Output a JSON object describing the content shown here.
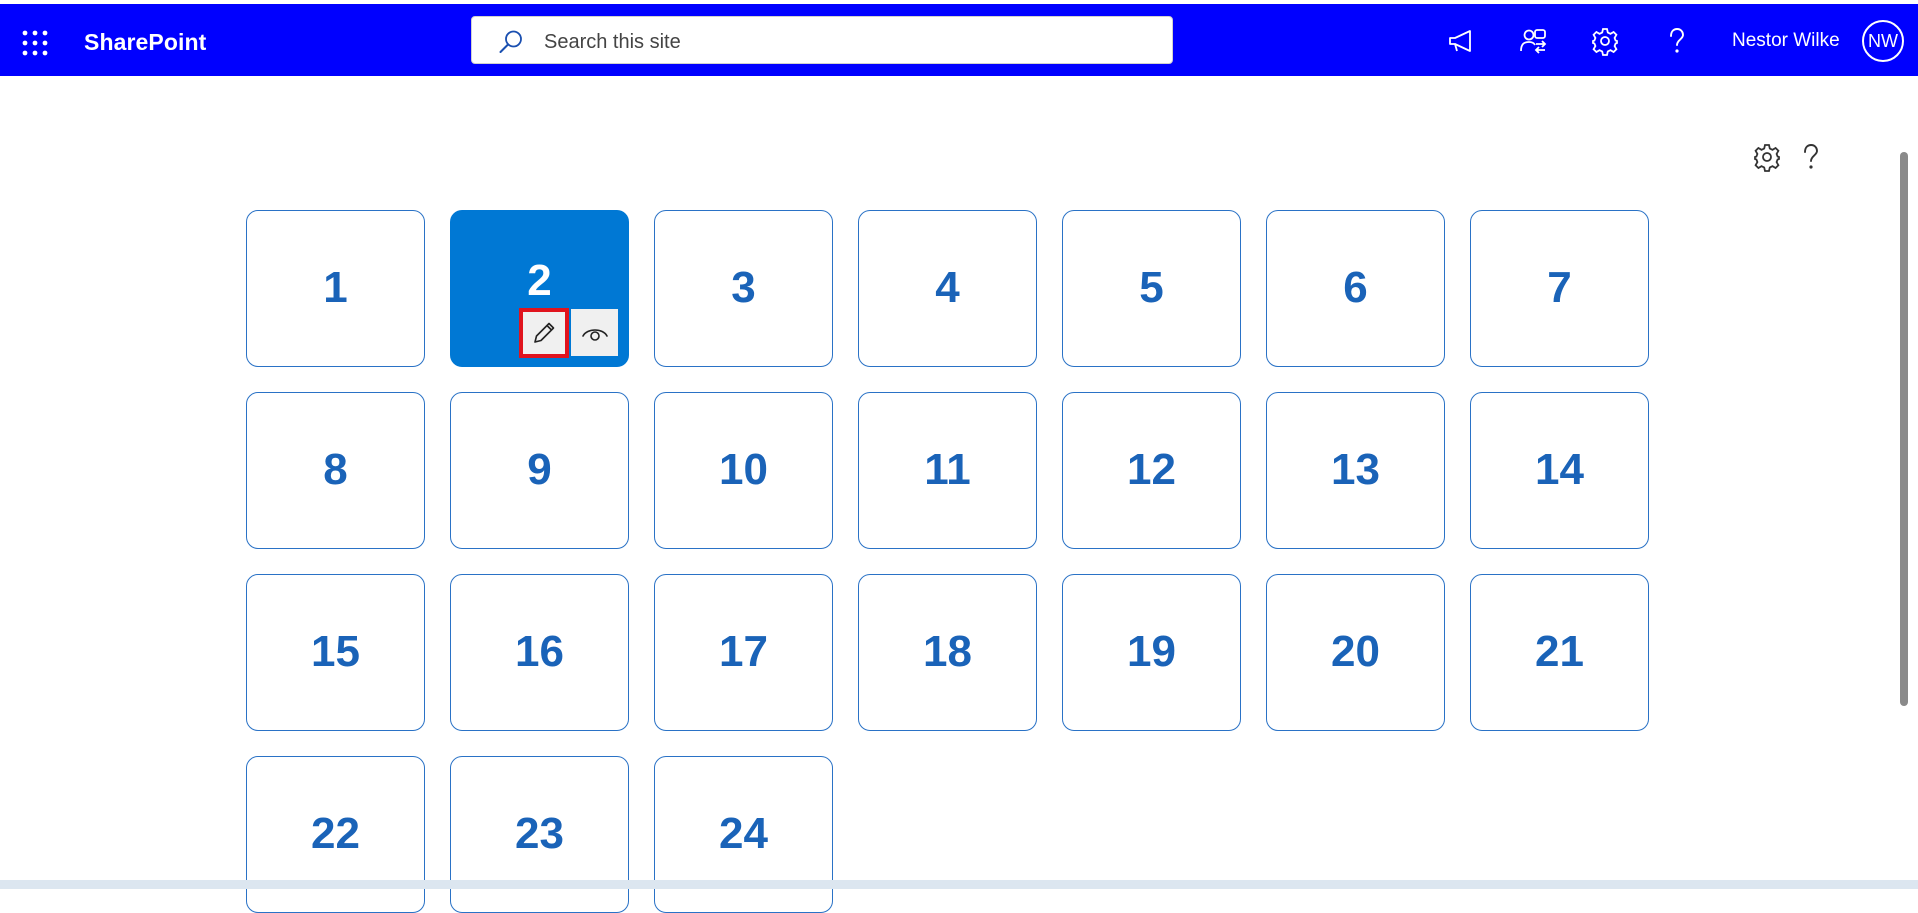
{
  "suite_bar": {
    "brand": "SharePoint",
    "background": "#0000ff",
    "search": {
      "placeholder": "Search this site",
      "value": ""
    },
    "icons": [
      "app-launcher-icon",
      "announcement-icon",
      "people-switch-icon",
      "gear-icon",
      "help-icon"
    ],
    "user": {
      "name": "Nestor Wilke",
      "initials": "NW"
    }
  },
  "page_tools": {
    "icons": [
      "gear-icon",
      "help-icon"
    ]
  },
  "grid": {
    "accent": "#2a72c6",
    "selected_fill": "#0078d4",
    "tiles": [
      "1",
      "2",
      "3",
      "4",
      "5",
      "6",
      "7",
      "8",
      "9",
      "10",
      "11",
      "12",
      "13",
      "14",
      "15",
      "16",
      "17",
      "18",
      "19",
      "20",
      "21",
      "22",
      "23",
      "24"
    ],
    "selected_tile": "2",
    "tile_actions": [
      "pencil-edit-icon",
      "eye-view-icon"
    ],
    "highlight_color": "#e0141e"
  }
}
